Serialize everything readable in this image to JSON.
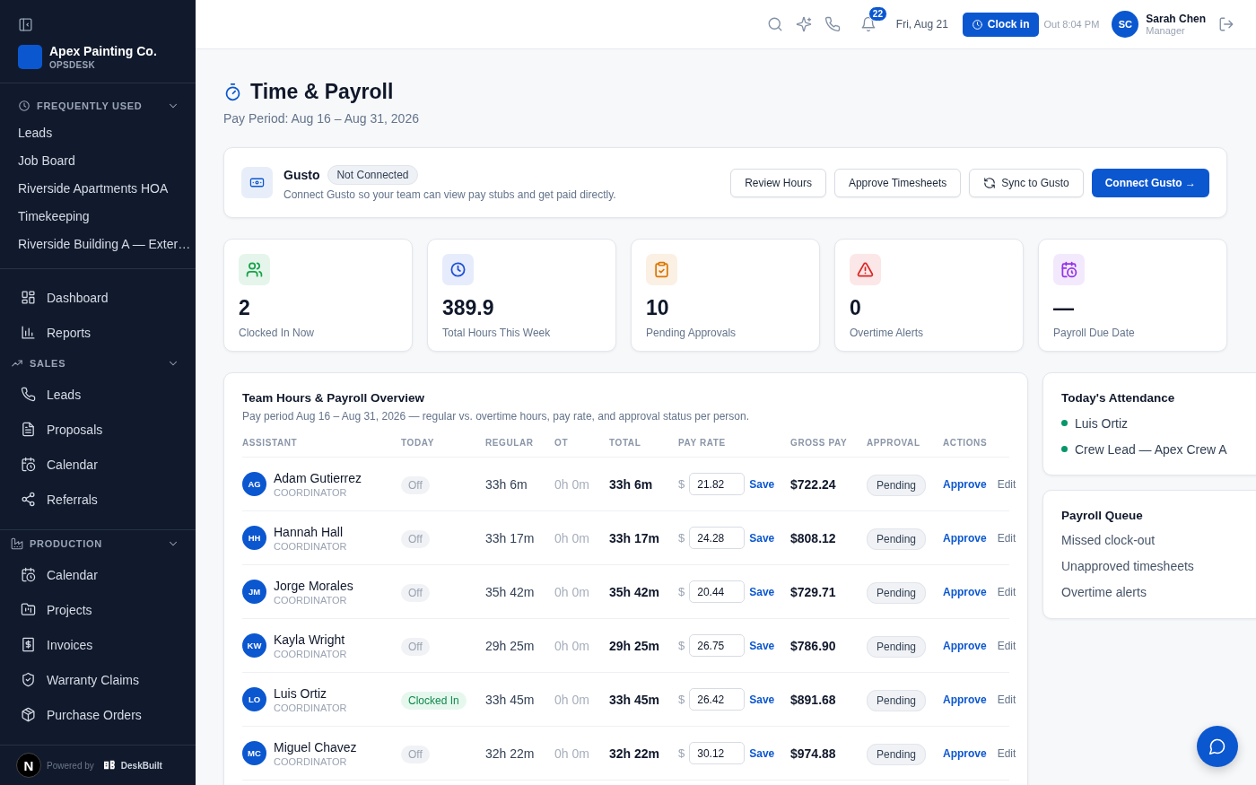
{
  "sidebar": {
    "brand": {
      "name": "Apex Painting Co.",
      "subtitle": "OPSDESK"
    },
    "frequently_used": {
      "title": "FREQUENTLY USED",
      "expanded": true,
      "items": [
        "Leads",
        "Job Board",
        "Riverside Apartments HOA",
        "Timekeeping",
        "Riverside Building A — Exter…"
      ]
    },
    "top_items": [
      "Dashboard",
      "Reports"
    ],
    "sections": [
      {
        "title": "SALES",
        "expanded": true,
        "items": [
          "Leads",
          "Proposals",
          "Calendar",
          "Referrals"
        ]
      },
      {
        "title": "PRODUCTION",
        "expanded": true,
        "items": [
          "Calendar",
          "Projects",
          "Invoices",
          "Warranty Claims",
          "Purchase Orders"
        ]
      }
    ],
    "footer": {
      "badge": "N",
      "powered_by": "Powered by",
      "product": "DeskBuilt"
    }
  },
  "header": {
    "notifications": "22",
    "date": "Fri, Aug 21",
    "clock_button": "Clock in",
    "out_time": "Out 8:04 PM",
    "user": {
      "initials": "SC",
      "name": "Sarah Chen",
      "role": "Manager"
    }
  },
  "page": {
    "title": "Time & Payroll",
    "subtitle": "Pay Period: Aug 16 – Aug 31, 2026"
  },
  "integration": {
    "name": "Gusto",
    "status": "Not Connected",
    "description": "Connect Gusto so your team can view pay stubs and get paid directly.",
    "buttons": [
      {
        "label": "Review Hours",
        "kind": "outline"
      },
      {
        "label": "Approve Timesheets",
        "kind": "outline"
      },
      {
        "label": "Sync to Gusto",
        "kind": "sync"
      },
      {
        "label": "Connect Gusto →",
        "kind": "primary"
      }
    ]
  },
  "stats": [
    {
      "value": "2",
      "label": "Clocked In Now",
      "color": "#16a34a"
    },
    {
      "value": "389.9",
      "label": "Total Hours This Week",
      "color": "#1d4ed8"
    },
    {
      "value": "10",
      "label": "Pending Approvals",
      "color": "#d97706"
    },
    {
      "value": "0",
      "label": "Overtime Alerts",
      "color": "#dc2626"
    },
    {
      "value": "—",
      "label": "Payroll Due Date",
      "color": "#9333ea"
    }
  ],
  "table": {
    "title": "Team Hours & Payroll Overview",
    "subtitle": "Pay period Aug 16 – Aug 31, 2026 — regular vs. overtime hours, pay rate, and approval status per person.",
    "columns": [
      "ASSISTANT",
      "TODAY",
      "REGULAR",
      "OT",
      "TOTAL",
      "PAY RATE",
      "GROSS PAY",
      "APPROVAL",
      "ACTIONS"
    ],
    "rows": [
      {
        "initials": "AG",
        "name": "Adam Gutierrez",
        "role": "COORDINATOR",
        "today": "Off",
        "clocked_in": false,
        "regular": "33h 6m",
        "ot": "0h 0m",
        "total": "33h 6m",
        "currency": "$",
        "rate": "21.82",
        "save": "Save",
        "gross": "$722.24",
        "approval": "Pending",
        "approve": "Approve",
        "edit": "Edit"
      },
      {
        "initials": "HH",
        "name": "Hannah Hall",
        "role": "COORDINATOR",
        "today": "Off",
        "clocked_in": false,
        "regular": "33h 17m",
        "ot": "0h 0m",
        "total": "33h 17m",
        "currency": "$",
        "rate": "24.28",
        "save": "Save",
        "gross": "$808.12",
        "approval": "Pending",
        "approve": "Approve",
        "edit": "Edit"
      },
      {
        "initials": "JM",
        "name": "Jorge Morales",
        "role": "COORDINATOR",
        "today": "Off",
        "clocked_in": false,
        "regular": "35h 42m",
        "ot": "0h 0m",
        "total": "35h 42m",
        "currency": "$",
        "rate": "20.44",
        "save": "Save",
        "gross": "$729.71",
        "approval": "Pending",
        "approve": "Approve",
        "edit": "Edit"
      },
      {
        "initials": "KW",
        "name": "Kayla Wright",
        "role": "COORDINATOR",
        "today": "Off",
        "clocked_in": false,
        "regular": "29h 25m",
        "ot": "0h 0m",
        "total": "29h 25m",
        "currency": "$",
        "rate": "26.75",
        "save": "Save",
        "gross": "$786.90",
        "approval": "Pending",
        "approve": "Approve",
        "edit": "Edit"
      },
      {
        "initials": "LO",
        "name": "Luis Ortiz",
        "role": "COORDINATOR",
        "today": "Clocked In",
        "clocked_in": true,
        "regular": "33h 45m",
        "ot": "0h 0m",
        "total": "33h 45m",
        "currency": "$",
        "rate": "26.42",
        "save": "Save",
        "gross": "$891.68",
        "approval": "Pending",
        "approve": "Approve",
        "edit": "Edit"
      },
      {
        "initials": "MC",
        "name": "Miguel Chavez",
        "role": "COORDINATOR",
        "today": "Off",
        "clocked_in": false,
        "regular": "32h 22m",
        "ot": "0h 0m",
        "total": "32h 22m",
        "currency": "$",
        "rate": "30.12",
        "save": "Save",
        "gross": "$974.88",
        "approval": "Pending",
        "approve": "Approve",
        "edit": "Edit"
      }
    ]
  },
  "attendance": {
    "title": "Today's Attendance",
    "items": [
      {
        "label": "Luis Ortiz",
        "color": "#059669"
      },
      {
        "label": "Crew Lead — Apex Crew A",
        "color": "#059669"
      }
    ]
  },
  "payroll_queue": {
    "title": "Payroll Queue",
    "items": [
      "Missed clock-out",
      "Unapproved timesheets",
      "Overtime alerts"
    ]
  }
}
